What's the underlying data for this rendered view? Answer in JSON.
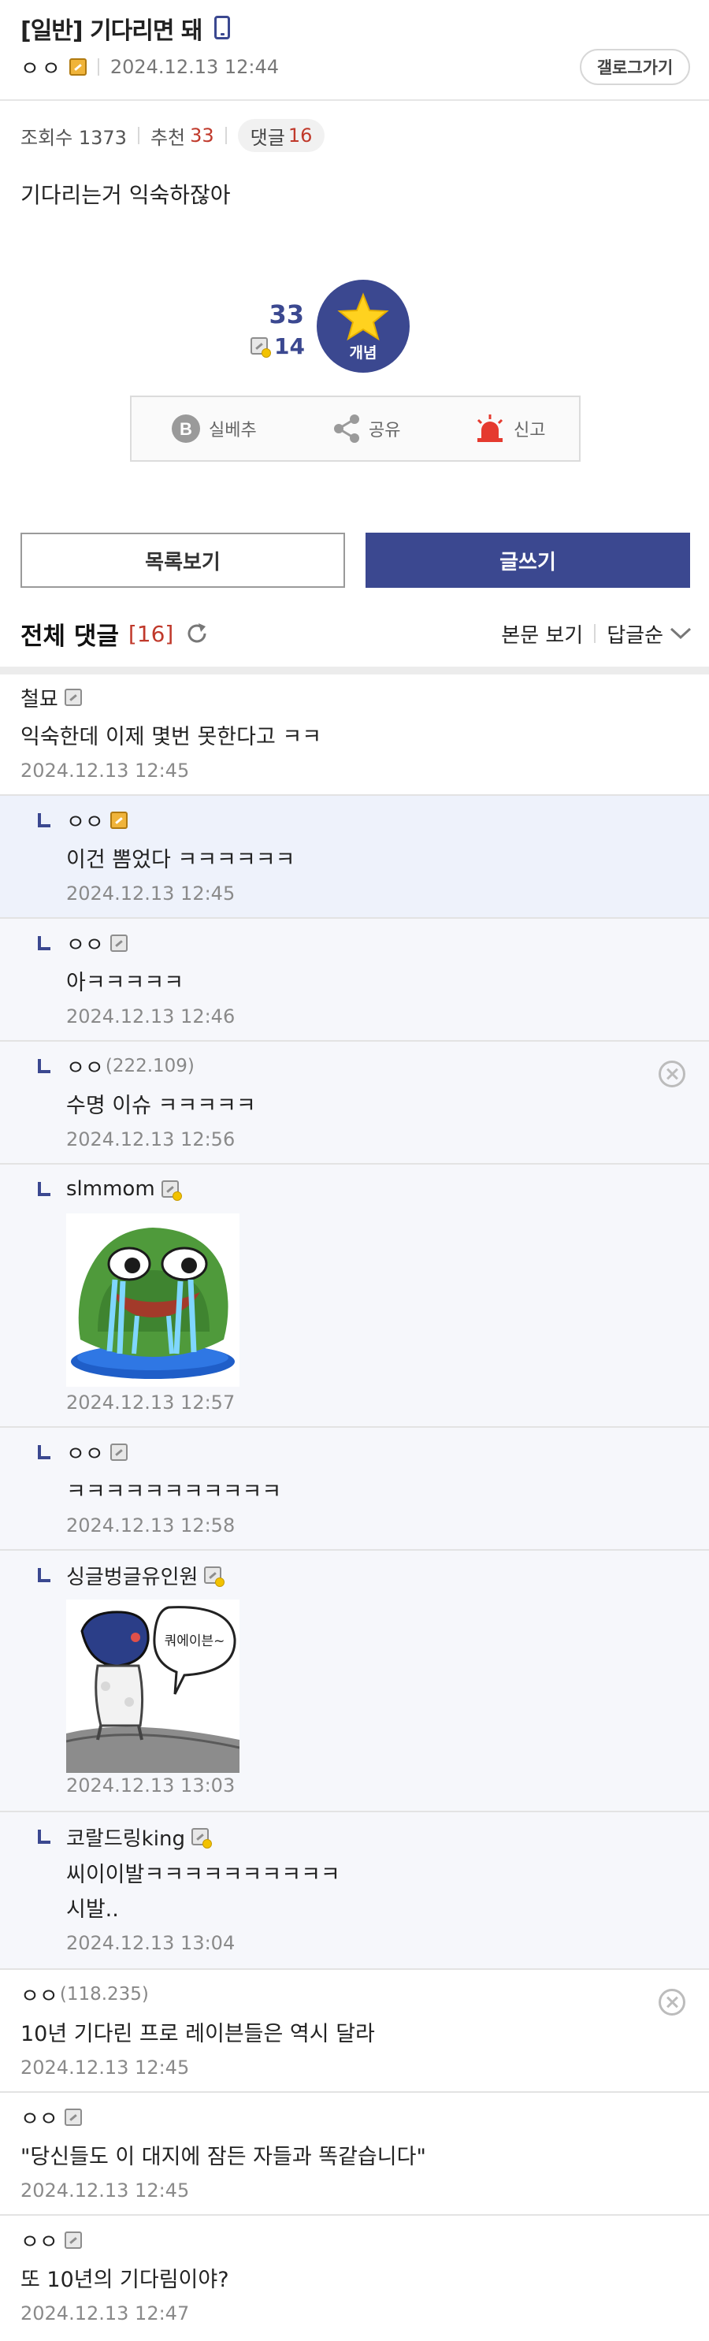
{
  "post": {
    "title": "[일반] 기다리면 돼",
    "author": "ㅇㅇ",
    "date": "2024.12.13 12:44",
    "gallog_label": "갤로그가기",
    "views_label": "조회수 1373",
    "recommend_label": "추천",
    "recommend_count": "33",
    "comments_label": "댓글",
    "comments_count": "16",
    "body": "기다리는거 익숙하잖아"
  },
  "vote": {
    "recommend": "33",
    "fixed_recommend": "14",
    "concept_label": "개념"
  },
  "actions": {
    "realbest": "실베추",
    "share": "공유",
    "report": "신고"
  },
  "buttons": {
    "list": "목록보기",
    "write": "글쓰기"
  },
  "comment_header": {
    "title": "전체 댓글",
    "count": "[16]",
    "view_body": "본문 보기",
    "sort": "답글순"
  },
  "comments": [
    {
      "nick": "철묘",
      "ip": "",
      "text": "익숙한데 이제 몇번 못한다고 ㅋㅋ",
      "date": "2024.12.13 12:45"
    },
    {
      "nick": "ㅇㅇ",
      "ip": "",
      "text": "이건 뽐었다 ㅋㅋㅋㅋㅋㅋ",
      "date": "2024.12.13 12:45"
    },
    {
      "nick": "ㅇㅇ",
      "ip": "",
      "text": "아ㅋㅋㅋㅋㅋ",
      "date": "2024.12.13 12:46"
    },
    {
      "nick": "ㅇㅇ",
      "ip": "(222.109)",
      "text": "수명 이슈 ㅋㅋㅋㅋㅋ",
      "date": "2024.12.13 12:56"
    },
    {
      "nick": "slmmom",
      "ip": "",
      "text": "",
      "date": "2024.12.13 12:57"
    },
    {
      "nick": "ㅇㅇ",
      "ip": "",
      "text": "ㅋㅋㅋㅋㅋㅋㅋㅋㅋㅋㅋ",
      "date": "2024.12.13 12:58"
    },
    {
      "nick": "싱글벙글유인원",
      "ip": "",
      "text": "",
      "date": "2024.12.13 13:03",
      "sticker_text": "쿼에이븐~"
    },
    {
      "nick": "코랄드링king",
      "ip": "",
      "text": "씨이이발ㅋㅋㅋㅋㅋㅋㅋㅋㅋㅋ",
      "text2": "시발..",
      "date": "2024.12.13 13:04"
    },
    {
      "nick": "ㅇㅇ",
      "ip": "(118.235)",
      "text": "10년 기다린 프로 레이븐들은 역시 달라",
      "date": "2024.12.13 12:45"
    },
    {
      "nick": "ㅇㅇ",
      "ip": "",
      "text": "\"당신들도 이 대지에 잠든 자들과 똑같습니다\"",
      "date": "2024.12.13 12:45"
    },
    {
      "nick": "ㅇㅇ",
      "ip": "",
      "text": "또 10년의 기다림이야?",
      "date": "2024.12.13 12:47"
    }
  ],
  "colors": {
    "accent": "#3b4890",
    "red": "#c0392b",
    "reply_bg": "#f6f7fb"
  },
  "icons": [
    "mobile-icon",
    "star-icon",
    "realbest-icon",
    "share-icon",
    "siren-icon",
    "refresh-icon",
    "chevron-down-icon",
    "delete-icon",
    "reply-arrow-icon"
  ]
}
